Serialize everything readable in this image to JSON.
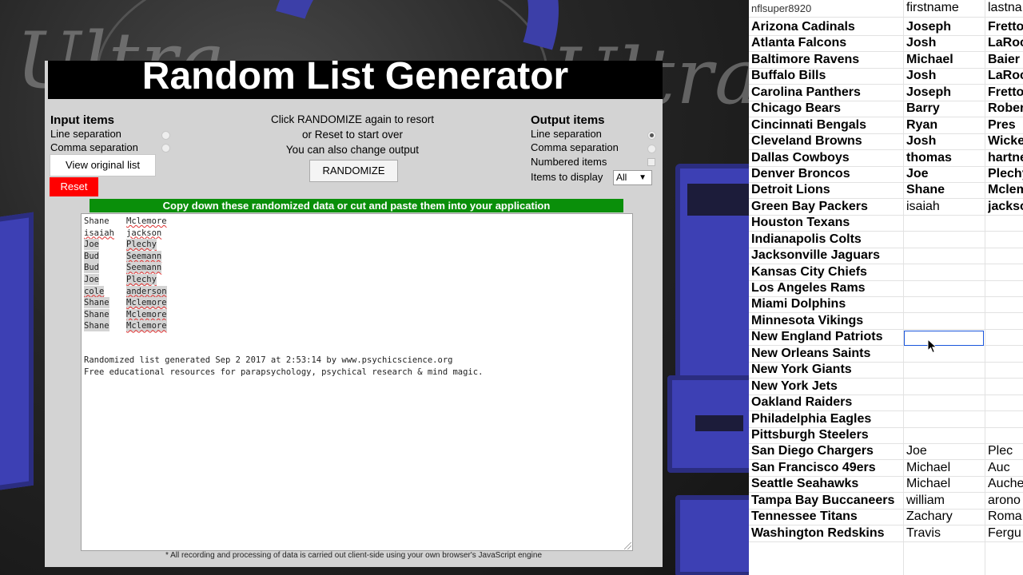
{
  "background": {
    "watermark_words": [
      "Ultra",
      "Ultra"
    ]
  },
  "generator": {
    "title": "Random List Generator",
    "input": {
      "heading": "Input items",
      "line_sep": "Line separation",
      "comma_sep": "Comma separation",
      "view_button": "View original list",
      "reset_button": "Reset"
    },
    "instructions": [
      "Click RANDOMIZE again to resort",
      "or Reset to start over",
      "You can also change output"
    ],
    "randomize_button": "RANDOMIZE",
    "output": {
      "heading": "Output items",
      "line_sep": "Line separation",
      "comma_sep": "Comma separation",
      "numbered": "Numbered items",
      "display_label": "Items to display",
      "display_value": "All",
      "display_arrow": "▼"
    },
    "green_bar": "Copy down these randomized data or cut and paste them into your application",
    "result_rows": [
      {
        "first": "Shane",
        "last": "Mclemore"
      },
      {
        "first": "isaiah",
        "last": "jackson"
      },
      {
        "first": "Joe",
        "last": "Plechy"
      },
      {
        "first": "Bud",
        "last": "Seemann"
      },
      {
        "first": "Bud",
        "last": "Seemann"
      },
      {
        "first": "Joe",
        "last": "Plechy"
      },
      {
        "first": "cole",
        "last": "anderson"
      },
      {
        "first": "Shane",
        "last": "Mclemore"
      },
      {
        "first": "Shane",
        "last": "Mclemore"
      },
      {
        "first": "Shane",
        "last": "Mclemore"
      }
    ],
    "generated_line": "Randomized list generated Sep 2 2017 at 2:53:14 by www.psychicscience.org",
    "resources_line": "Free educational resources for parapsychology, psychical research & mind magic.",
    "disclaimer": "* All recording and processing of data is carried out client-side using your own browser's JavaScript engine"
  },
  "sheet": {
    "header": {
      "a": "nflsuper8920",
      "b": "firstname",
      "c": "lastna"
    },
    "rows": [
      {
        "team": "Arizona Cadinals",
        "first": "Joseph",
        "last": "Fretto"
      },
      {
        "team": "Atlanta Falcons",
        "first": "Josh",
        "last": "LaRoc"
      },
      {
        "team": "Baltimore Ravens",
        "first": "Michael",
        "last": "Baier"
      },
      {
        "team": "Buffalo Bills",
        "first": "Josh",
        "last": "LaRoc"
      },
      {
        "team": "Carolina Panthers",
        "first": "Joseph",
        "last": "Fretto"
      },
      {
        "team": "Chicago Bears",
        "first": "Barry",
        "last": "Rober"
      },
      {
        "team": "Cincinnati Bengals",
        "first": "Ryan",
        "last": "Pres"
      },
      {
        "team": "Cleveland Browns",
        "first": "Josh",
        "last": "Wicke"
      },
      {
        "team": "Dallas Cowboys",
        "first": "thomas",
        "last": "hartne"
      },
      {
        "team": "Denver Broncos",
        "first": "Joe",
        "last": "Plechy"
      },
      {
        "team": "Detroit Lions",
        "first": "Shane",
        "last": "Mclem"
      },
      {
        "team": "Green Bay Packers",
        "first": "isaiah",
        "last": "jackso"
      },
      {
        "team": "Houston Texans",
        "first": "",
        "last": ""
      },
      {
        "team": "Indianapolis Colts",
        "first": "",
        "last": ""
      },
      {
        "team": "Jacksonville Jaguars",
        "first": "",
        "last": ""
      },
      {
        "team": "Kansas City Chiefs",
        "first": "",
        "last": ""
      },
      {
        "team": "Los Angeles Rams",
        "first": "",
        "last": ""
      },
      {
        "team": "Miami Dolphins",
        "first": "",
        "last": ""
      },
      {
        "team": "Minnesota Vikings",
        "first": "",
        "last": ""
      },
      {
        "team": "New England Patriots",
        "first": "",
        "last": ""
      },
      {
        "team": "New Orleans Saints",
        "first": "",
        "last": ""
      },
      {
        "team": "New York Giants",
        "first": "",
        "last": ""
      },
      {
        "team": "New York Jets",
        "first": "",
        "last": ""
      },
      {
        "team": "Oakland Raiders",
        "first": "",
        "last": ""
      },
      {
        "team": "Philadelphia Eagles",
        "first": "",
        "last": ""
      },
      {
        "team": "Pittsburgh Steelers",
        "first": "",
        "last": ""
      },
      {
        "team": "San Diego Chargers",
        "first": "Joe",
        "last": "Plec"
      },
      {
        "team": "San Francisco 49ers",
        "first": "Michael",
        "last": "Auc"
      },
      {
        "team": "Seattle Seahawks",
        "first": "Michael",
        "last": "Auche"
      },
      {
        "team": "Tampa Bay Buccaneers",
        "first": "william",
        "last": "arono"
      },
      {
        "team": "Tennessee Titans",
        "first": "Zachary",
        "last": "Roma"
      },
      {
        "team": "Washington Redskins",
        "first": "Travis",
        "last": "Fergu"
      }
    ]
  }
}
